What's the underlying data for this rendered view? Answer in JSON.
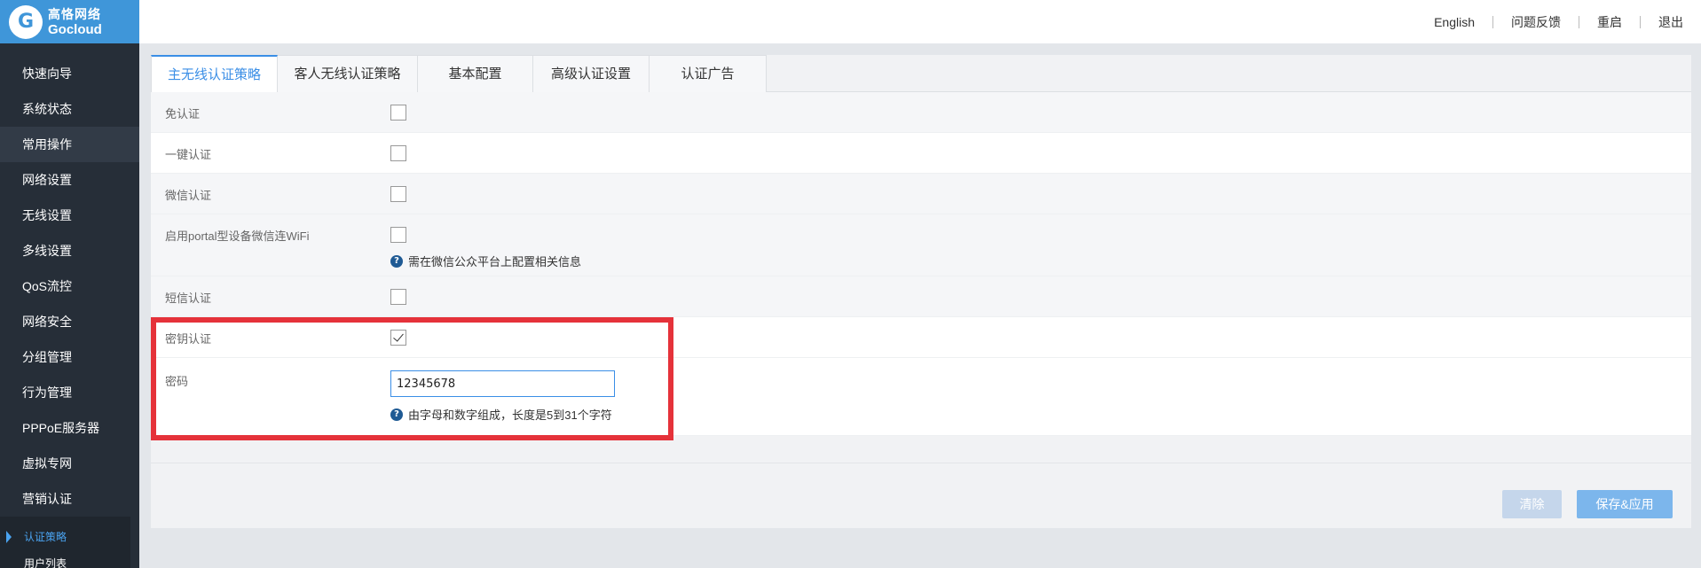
{
  "brand": {
    "cn": "高恪网络",
    "en": "Gocloud",
    "logo_letter": "G"
  },
  "topbar": {
    "links": [
      "English",
      "问题反馈",
      "重启",
      "退出"
    ]
  },
  "sidebar": {
    "items": [
      {
        "label": "快速向导"
      },
      {
        "label": "系统状态"
      },
      {
        "label": "常用操作"
      },
      {
        "label": "网络设置"
      },
      {
        "label": "无线设置"
      },
      {
        "label": "多线设置"
      },
      {
        "label": "QoS流控"
      },
      {
        "label": "网络安全"
      },
      {
        "label": "分组管理"
      },
      {
        "label": "行为管理"
      },
      {
        "label": "PPPoE服务器"
      },
      {
        "label": "虚拟专网"
      },
      {
        "label": "营销认证"
      }
    ],
    "subitems": [
      {
        "label": "认证策略"
      },
      {
        "label": "用户列表"
      }
    ]
  },
  "tabs": [
    "主无线认证策略",
    "客人无线认证策略",
    "基本配置",
    "高级认证设置",
    "认证广告"
  ],
  "form": {
    "free_auth": {
      "label": "免认证",
      "checked": false
    },
    "one_key_auth": {
      "label": "一键认证",
      "checked": false
    },
    "wechat_auth": {
      "label": "微信认证",
      "checked": false
    },
    "portal_wifi": {
      "label": "启用portal型设备微信连WiFi",
      "checked": false,
      "hint": "需在微信公众平台上配置相关信息"
    },
    "sms_auth": {
      "label": "短信认证",
      "checked": false
    },
    "key_auth": {
      "label": "密钥认证",
      "checked": true
    },
    "password": {
      "label": "密码",
      "value": "12345678",
      "hint": "由字母和数字组成，长度是5到31个字符"
    }
  },
  "buttons": {
    "clear": "清除",
    "save": "保存&应用"
  },
  "colors": {
    "accent": "#3a8ee6",
    "highlight": "#e5323a",
    "sidebar_bg": "#262e38",
    "logo_bg": "#3f96d9"
  }
}
